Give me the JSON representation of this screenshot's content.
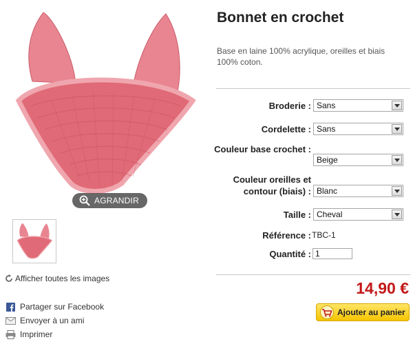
{
  "product": {
    "title": "Bonnet en crochet",
    "description": "Base en laine 100% acrylique, oreilles et biais 100% coton."
  },
  "image": {
    "zoom_label": "AGRANDIR",
    "show_all_label": "Afficher toutes les images",
    "color_main": "#e3707c"
  },
  "options": [
    {
      "label": "Broderie :",
      "value": "Sans"
    },
    {
      "label": "Cordelette :",
      "value": "Sans"
    },
    {
      "label": "Couleur base crochet :",
      "value": "Beige"
    },
    {
      "label_line1": "Couleur oreilles et",
      "label_line2": "contour (biais) :",
      "value": "Blanc"
    },
    {
      "label": "Taille :",
      "value": "Cheval"
    }
  ],
  "reference": {
    "label": "Référence :",
    "value": "TBC-1"
  },
  "quantity": {
    "label": "Quantité :",
    "value": "1"
  },
  "price": "14,90 €",
  "add_to_cart_label": "Ajouter au panier",
  "actions": {
    "facebook": "Partager sur Facebook",
    "email": "Envoyer à un ami",
    "print": "Imprimer"
  }
}
